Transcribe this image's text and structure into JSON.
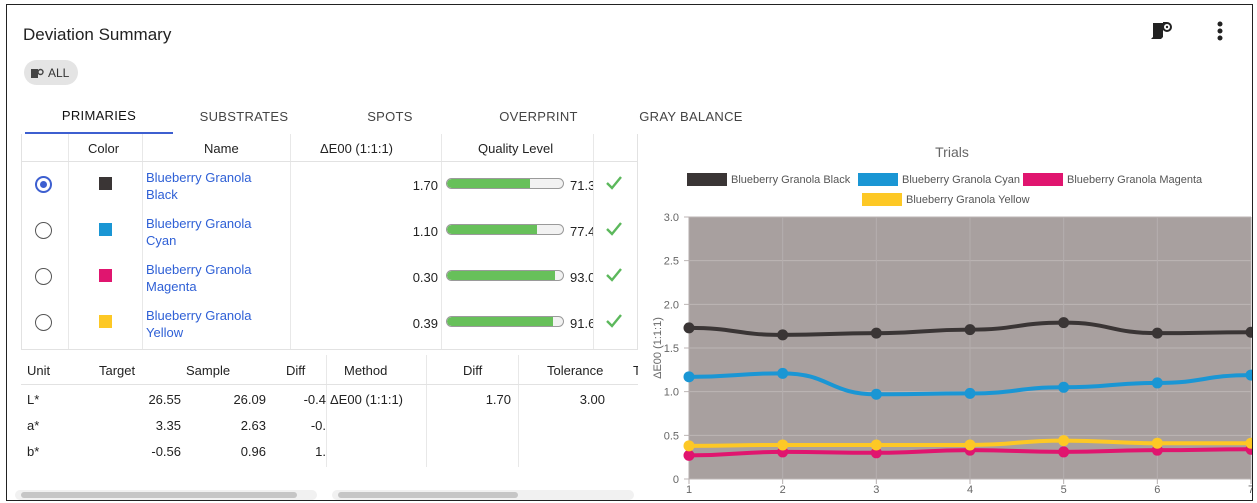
{
  "header": {
    "title": "Deviation Summary",
    "chip_label": "ALL"
  },
  "tabs": [
    "PRIMARIES",
    "SUBSTRATES",
    "SPOTS",
    "OVERPRINT",
    "GRAY BALANCE"
  ],
  "color_table": {
    "columns": [
      "Color",
      "Name",
      "ΔE00 (1:1:1)",
      "Quality Level"
    ],
    "rows": [
      {
        "selected": true,
        "swatch": "#3a3535",
        "name": "Blueberry Granola Black",
        "name_line1": "Blueberry Granola",
        "name_line2": "Black",
        "de": "1.70",
        "quality": "71.3",
        "quality_fraction": 0.713
      },
      {
        "selected": false,
        "swatch": "#1a96d4",
        "name": "Blueberry Granola Cyan",
        "name_line1": "Blueberry Granola",
        "name_line2": "Cyan",
        "de": "1.10",
        "quality": "77.4",
        "quality_fraction": 0.774
      },
      {
        "selected": false,
        "swatch": "#e0156f",
        "name": "Blueberry Granola Magenta",
        "name_line1": "Blueberry Granola",
        "name_line2": "Magenta",
        "de": "0.30",
        "quality": "93.0",
        "quality_fraction": 0.93
      },
      {
        "selected": false,
        "swatch": "#fdc825",
        "name": "Blueberry Granola Yellow",
        "name_line1": "Blueberry Granola",
        "name_line2": "Yellow",
        "de": "0.39",
        "quality": "91.6",
        "quality_fraction": 0.916
      }
    ]
  },
  "detail_table": {
    "columns": [
      "Unit",
      "Target",
      "Sample",
      "Diff",
      "Method",
      "Diff",
      "Tolerance",
      "T"
    ],
    "rows": [
      {
        "unit": "L*",
        "target": "26.55",
        "sample": "26.09",
        "diff": "-0.4",
        "method": "ΔE00 (1:1:1)",
        "diff2": "1.70",
        "tolerance": "3.00"
      },
      {
        "unit": "a*",
        "target": "3.35",
        "sample": "2.63",
        "diff": "-0.",
        "method": "",
        "diff2": "",
        "tolerance": ""
      },
      {
        "unit": "b*",
        "target": "-0.56",
        "sample": "0.96",
        "diff": "1.",
        "method": "",
        "diff2": "",
        "tolerance": ""
      }
    ]
  },
  "chart_data": {
    "type": "line",
    "title": "Trials",
    "xlabel": "",
    "ylabel": "ΔE00 (1:1:1)",
    "x": [
      1,
      2,
      3,
      4,
      5,
      6,
      7
    ],
    "ylim": [
      0,
      3.0
    ],
    "yticks": [
      "0",
      "0.5",
      "1.0",
      "1.5",
      "2.0",
      "2.5",
      "3.0"
    ],
    "plot_background": "#a8a09f",
    "grid": true,
    "legend_position": "top",
    "series": [
      {
        "name": "Blueberry Granola Black",
        "color": "#3a3535",
        "values": [
          1.73,
          1.65,
          1.67,
          1.71,
          1.79,
          1.67,
          1.68
        ]
      },
      {
        "name": "Blueberry Granola Cyan",
        "color": "#1a96d4",
        "values": [
          1.17,
          1.21,
          0.97,
          0.98,
          1.05,
          1.1,
          1.19
        ]
      },
      {
        "name": "Blueberry Granola Magenta",
        "color": "#e0156f",
        "values": [
          0.27,
          0.31,
          0.3,
          0.33,
          0.31,
          0.33,
          0.34
        ]
      },
      {
        "name": "Blueberry Granola Yellow",
        "color": "#fdc825",
        "values": [
          0.38,
          0.39,
          0.39,
          0.39,
          0.44,
          0.41,
          0.41
        ]
      }
    ]
  },
  "icons": {
    "toolbar": [
      "paper-roll-icon",
      "more-vert-icon"
    ],
    "chip": "paper-roll-icon",
    "status": "check-icon"
  }
}
